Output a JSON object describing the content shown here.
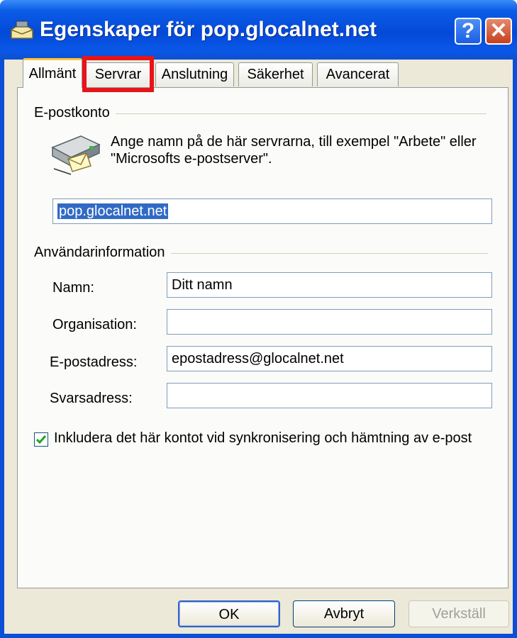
{
  "window": {
    "title": "Egenskaper för pop.glocalnet.net",
    "help_label": "?",
    "close_label": "✕"
  },
  "tabs": [
    {
      "label": "Allmänt",
      "active": true
    },
    {
      "label": "Servrar",
      "highlighted": true,
      "highlight_color": "#e8141a"
    },
    {
      "label": "Anslutning"
    },
    {
      "label": "Säkerhet"
    },
    {
      "label": "Avancerat"
    }
  ],
  "account_group": {
    "title": "E-postkonto",
    "icon": "mail-server-icon",
    "description": "Ange namn på de här servrarna, till exempel \"Arbete\" eller \"Microsofts e-postserver\".",
    "account_name": "pop.glocalnet.net"
  },
  "user_group": {
    "title": "Användarinformation",
    "fields": [
      {
        "label": "Namn:",
        "value": "Ditt namn"
      },
      {
        "label": "Organisation:",
        "value": ""
      },
      {
        "label": "E-postadress:",
        "value": "epostadress@glocalnet.net"
      },
      {
        "label": "Svarsadress:",
        "value": ""
      }
    ]
  },
  "include_checkbox": {
    "label": "Inkludera det här kontot vid synkronisering och hämtning av e-post",
    "checked": true
  },
  "buttons": {
    "ok": "OK",
    "cancel": "Avbryt",
    "apply": "Verkställ"
  },
  "colors": {
    "title_bar": "#0449d8",
    "active_tab_accent": "#ffc83c",
    "selection": "#316ac5",
    "check_green": "#21a121"
  }
}
